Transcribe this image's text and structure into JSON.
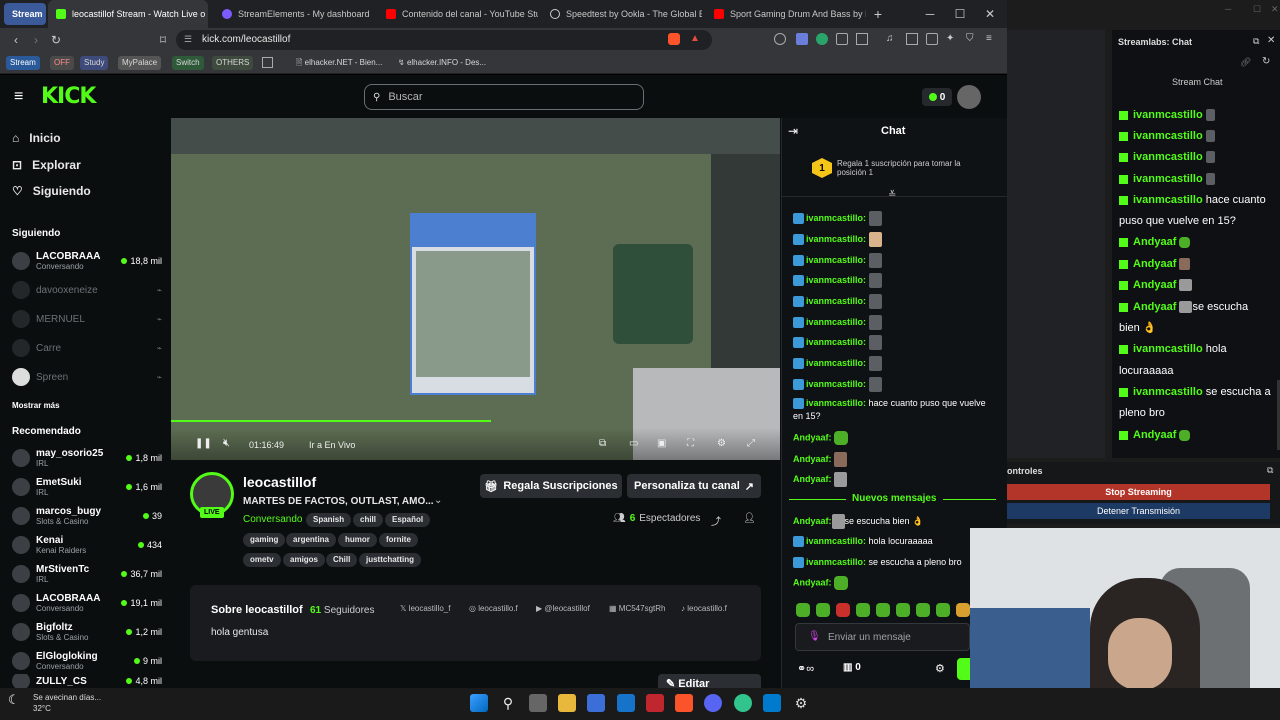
{
  "browser": {
    "tabs": [
      {
        "label": "Stream",
        "color": "#2b5aa8"
      },
      {
        "label": "leocastillof Stream - Watch Live o",
        "color": "#53fc18"
      },
      {
        "label": "StreamElements - My dashboard",
        "color": "#7c5cff"
      },
      {
        "label": "Contenido del canal - YouTube Studi",
        "color": "#ff0000"
      },
      {
        "label": "Speedtest by Ookla - The Global Bro",
        "color": "#ffffff"
      },
      {
        "label": "Sport Gaming Drum And Bass by Inf",
        "color": "#ff0000"
      }
    ],
    "url": "kick.com/leocastillof",
    "bookmarks": [
      "Stream",
      "OFF",
      "Study",
      "MyPalace",
      "Switch",
      "OTHERS",
      "elhacker.NET - Bien...",
      "elhacker.INFO - Des..."
    ]
  },
  "kick": {
    "search_placeholder": "Buscar",
    "kicks_count": "0",
    "nav": [
      {
        "label": "Inicio",
        "icon": "home-icon"
      },
      {
        "label": "Explorar",
        "icon": "compass-icon"
      },
      {
        "label": "Siguiendo",
        "icon": "heart-icon"
      }
    ],
    "following_title": "Siguiendo",
    "following": [
      {
        "name": "LACOBRAAA",
        "sub": "Conversando",
        "viewers": "18,8 mil",
        "online": true
      },
      {
        "name": "davooxeneize",
        "sub": "",
        "viewers": "",
        "online": false
      },
      {
        "name": "MERNUEL",
        "sub": "",
        "viewers": "",
        "online": false
      },
      {
        "name": "Carre",
        "sub": "",
        "viewers": "",
        "online": false
      },
      {
        "name": "Spreen",
        "sub": "",
        "viewers": "",
        "online": false
      }
    ],
    "show_more": "Mostrar más",
    "recommended_title": "Recomendado",
    "recommended": [
      {
        "name": "may_osorio25",
        "sub": "IRL",
        "viewers": "1,8 mil"
      },
      {
        "name": "EmetSuki",
        "sub": "IRL",
        "viewers": "1,6 mil"
      },
      {
        "name": "marcos_bugy",
        "sub": "Slots & Casino",
        "viewers": "39"
      },
      {
        "name": "Kenai",
        "sub": "Kenai Raiders",
        "viewers": "434"
      },
      {
        "name": "MrStivenTc",
        "sub": "IRL",
        "viewers": "36,7 mil"
      },
      {
        "name": "LACOBRAAA",
        "sub": "Conversando",
        "viewers": "19,1 mil"
      },
      {
        "name": "Bigfoltz",
        "sub": "Slots & Casino",
        "viewers": "1,2 mil"
      },
      {
        "name": "ElGlogloking",
        "sub": "Conversando",
        "viewers": "9 mil"
      },
      {
        "name": "ZULLY_CS",
        "sub": "",
        "viewers": "4,8 mil"
      }
    ],
    "player": {
      "time": "01:16:49",
      "live_label": "Ir a En Vivo"
    },
    "channel": {
      "name": "leocastillof",
      "live_badge": "LIVE",
      "title": "MARTES DE FACTOS, OUTLAST, AMO...",
      "category": "Conversando",
      "tags": [
        "Spanish",
        "chill",
        "Español",
        "gaming",
        "argentina",
        "humor",
        "fornite",
        "ometv",
        "amigos",
        "Chill",
        "justtchatting"
      ],
      "gift_label": "Regala Suscripciones",
      "customize_label": "Personaliza tu canal",
      "viewers_count": "6",
      "viewers_label": "Espectadores"
    },
    "about": {
      "title": "Sobre leocastillof",
      "followers_count": "61",
      "followers_label": "Seguidores",
      "bio": "hola gentusa",
      "socials": [
        {
          "label": "leocastillo_f",
          "icon": "x-icon"
        },
        {
          "label": "leocastillo.f",
          "icon": "instagram-icon"
        },
        {
          "label": "@leocastillof",
          "icon": "youtube-icon"
        },
        {
          "label": "MC547sgtRh",
          "icon": "discord-icon"
        },
        {
          "label": "leocastillo.f",
          "icon": "tiktok-icon"
        }
      ],
      "edit_panels": "Editar paneles"
    },
    "chat": {
      "title": "Chat",
      "gift_num": "1",
      "gift_text": "Regala 1 suscripción para tomar la posición 1",
      "messages": [
        {
          "user": "ivanmcastillo:",
          "text": ""
        },
        {
          "user": "ivanmcastillo:",
          "text": ""
        },
        {
          "user": "ivanmcastillo:",
          "text": ""
        },
        {
          "user": "ivanmcastillo:",
          "text": ""
        },
        {
          "user": "ivanmcastillo:",
          "text": ""
        },
        {
          "user": "ivanmcastillo:",
          "text": ""
        },
        {
          "user": "ivanmcastillo:",
          "text": ""
        },
        {
          "user": "ivanmcastillo:",
          "text": ""
        },
        {
          "user": "ivanmcastillo:",
          "text": ""
        },
        {
          "user": "ivanmcastillo:",
          "text": "hace cuanto puso que vuelve en 15?"
        },
        {
          "user": "Andyaaf:",
          "text": ""
        },
        {
          "user": "Andyaaf:",
          "text": ""
        },
        {
          "user": "Andyaaf:",
          "text": ""
        }
      ],
      "new_messages": "Nuevos mensajes",
      "new": [
        {
          "user": "Andyaaf:",
          "text": "se escucha bien 👌"
        },
        {
          "user": "ivanmcastillo:",
          "text": "hola locuraaaaa"
        },
        {
          "user": "ivanmcastillo:",
          "text": "se escucha a pleno bro"
        },
        {
          "user": "Andyaaf:",
          "text": ""
        }
      ],
      "input_placeholder": "Enviar un mensaje",
      "points": "0"
    }
  },
  "streamlabs": {
    "title": "Streamlabs: Chat",
    "subtitle": "Stream Chat",
    "messages": [
      {
        "user": "ivanmcastillo",
        "text": ""
      },
      {
        "user": "ivanmcastillo",
        "text": ""
      },
      {
        "user": "ivanmcastillo",
        "text": ""
      },
      {
        "user": "ivanmcastillo",
        "text": ""
      },
      {
        "user": "ivanmcastillo",
        "text": "hace cuanto"
      },
      {
        "user": "",
        "text": "puso que vuelve en 15?"
      },
      {
        "user": "Andyaaf",
        "text": ""
      },
      {
        "user": "Andyaaf",
        "text": ""
      },
      {
        "user": "Andyaaf",
        "text": ""
      },
      {
        "user": "Andyaaf",
        "text": "se escucha"
      },
      {
        "user": "",
        "text": "bien 👌"
      },
      {
        "user": "ivanmcastillo",
        "text": "hola"
      },
      {
        "user": "",
        "text": "locuraaaaa"
      },
      {
        "user": "ivanmcastillo",
        "text": "se escucha a"
      },
      {
        "user": "",
        "text": "pleno bro"
      },
      {
        "user": "Andyaaf",
        "text": ""
      }
    ],
    "controls_title": "ontroles",
    "stop_streaming": "Stop Streaming",
    "stop_transmission": "Detener Transmisión"
  },
  "taskbar": {
    "weather": "Se avecinan días...",
    "temp": "32°C"
  }
}
